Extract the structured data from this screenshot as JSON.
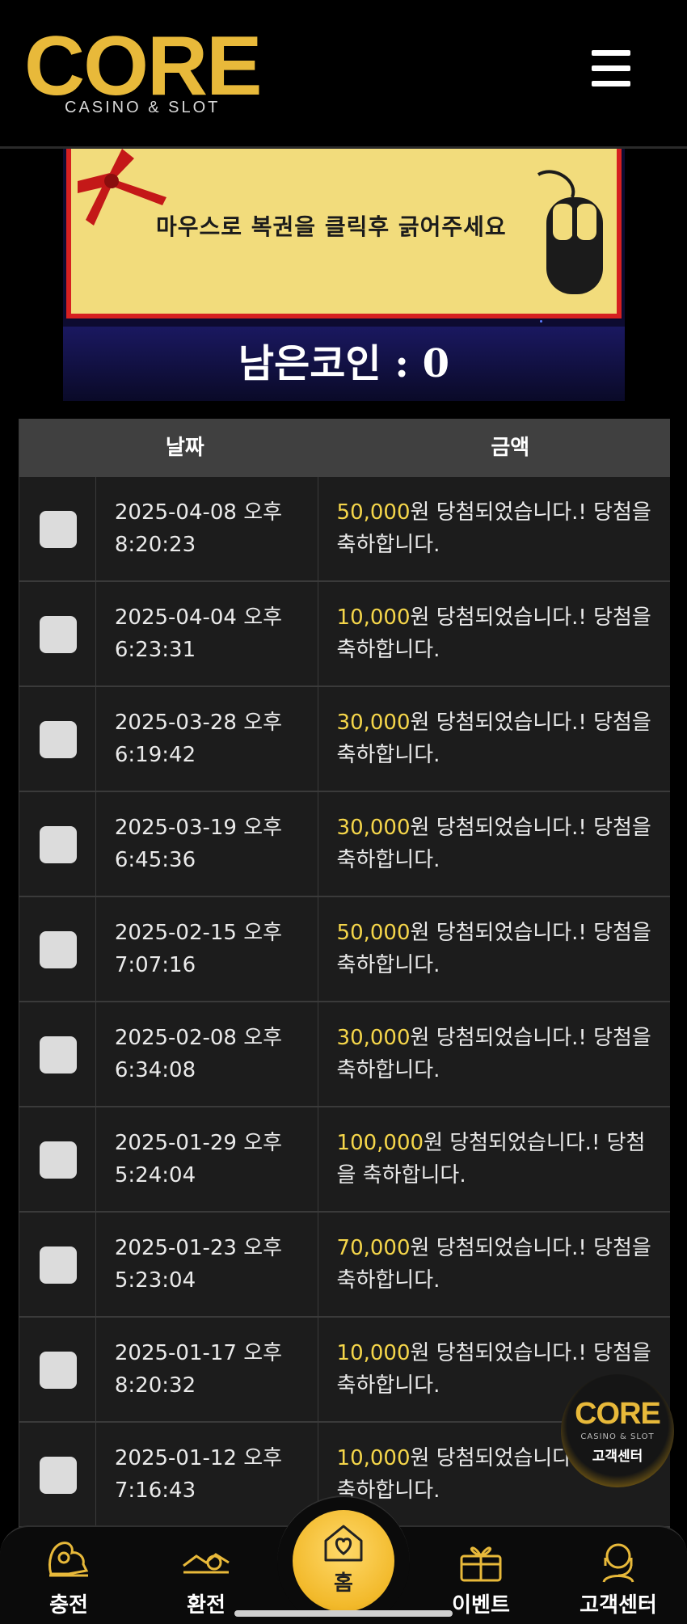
{
  "header": {
    "logo_word": "CORE",
    "logo_sub": "CASINO & SLOT"
  },
  "scratch_card": {
    "instruction": "마우스로 복권을 클릭후 긁어주세요",
    "remaining_coins": "남은코인 : 0"
  },
  "table": {
    "headers": {
      "date": "날짜",
      "amount": "금액"
    },
    "rows": [
      {
        "date": "2025-04-08 오후 8:20:23",
        "amount": "50,000",
        "msg": "원 당첨되었습니다.! 당첨을 축하합니다."
      },
      {
        "date": "2025-04-04 오후 6:23:31",
        "amount": "10,000",
        "msg": "원 당첨되었습니다.! 당첨을 축하합니다."
      },
      {
        "date": "2025-03-28 오후 6:19:42",
        "amount": "30,000",
        "msg": "원 당첨되었습니다.! 당첨을 축하합니다."
      },
      {
        "date": "2025-03-19 오후 6:45:36",
        "amount": "30,000",
        "msg": "원 당첨되었습니다.! 당첨을 축하합니다."
      },
      {
        "date": "2025-02-15 오후 7:07:16",
        "amount": "50,000",
        "msg": "원 당첨되었습니다.! 당첨을 축하합니다."
      },
      {
        "date": "2025-02-08 오후 6:34:08",
        "amount": "30,000",
        "msg": "원 당첨되었습니다.! 당첨을 축하합니다."
      },
      {
        "date": "2025-01-29 오후 5:24:04",
        "amount": "100,000",
        "msg": "원 당첨되었습니다.! 당첨을 축하합니다."
      },
      {
        "date": "2025-01-23 오후 5:23:04",
        "amount": "70,000",
        "msg": "원 당첨되었습니다.! 당첨을 축하합니다."
      },
      {
        "date": "2025-01-17 오후 8:20:32",
        "amount": "10,000",
        "msg": "원 당첨되었습니다.! 당첨을 축하합니다."
      },
      {
        "date": "2025-01-12 오후 7:16:43",
        "amount": "10,000",
        "msg": "원 당첨되었습니다.! 당첨을 축하합니다."
      }
    ]
  },
  "support_badge": {
    "logo": "CORE",
    "sub": "CASINO & SLOT",
    "label": "고객센터"
  },
  "bottom_nav": {
    "deposit": "충전",
    "withdraw": "환전",
    "home": "홈",
    "event": "이벤트",
    "support": "고객센터"
  },
  "colors": {
    "accent_gold": "#f2b92a",
    "amount_yellow": "#f5d64a",
    "card_yellow": "#f2dc7c",
    "card_border_red": "#d62020"
  },
  "icons": [
    "menu-icon",
    "ribbon-icon",
    "mouse-icon",
    "deposit-icon",
    "withdraw-icon",
    "home-heart-icon",
    "gift-icon",
    "headset-icon"
  ]
}
